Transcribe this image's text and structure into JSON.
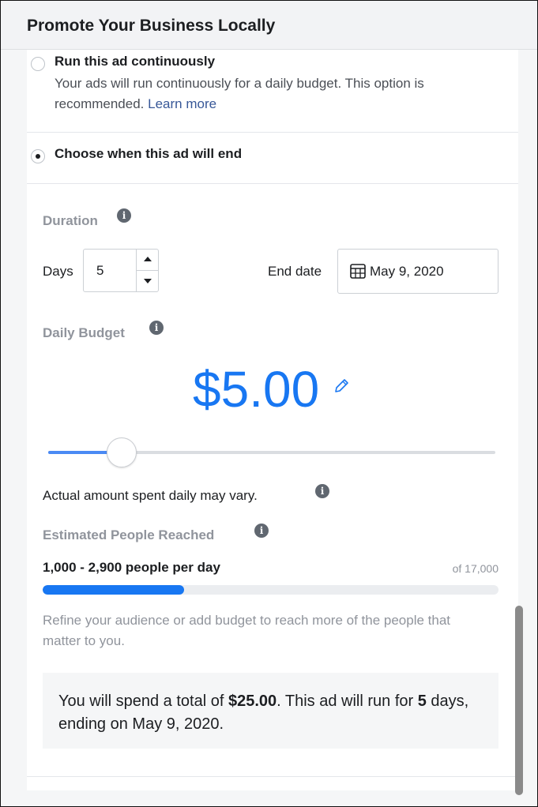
{
  "header": {
    "title": "Promote Your Business Locally"
  },
  "schedule": {
    "continuous": {
      "label": "Run this ad continuously",
      "description": "Your ads will run continuously for a daily budget. This option is recommended.",
      "link": "Learn more",
      "selected": false
    },
    "end_date_option": {
      "label": "Choose when this ad will end",
      "selected": true
    }
  },
  "duration": {
    "section_label": "Duration",
    "days_label": "Days",
    "days_value": "5",
    "end_date_label": "End date",
    "end_date_value": "May 9, 2020"
  },
  "budget": {
    "section_label": "Daily Budget",
    "amount": "$5.00",
    "slider_fraction": 0.17,
    "note": "Actual amount spent daily may vary."
  },
  "reach": {
    "section_label": "Estimated People Reached",
    "range": "1,000 - 2,900 people per day",
    "total": "of 17,000",
    "fraction": 0.31,
    "hint": "Refine your audience or add budget to reach more of the people that matter to you."
  },
  "summary": {
    "prefix": "You will spend a total of ",
    "total": "$25.00",
    "middle": ". This ad will run for ",
    "days": "5",
    "suffix": " days, ending on May 9, 2020."
  },
  "colors": {
    "accent": "#1877f2",
    "slider_fill": "#4a8af4",
    "muted_text": "#90949c",
    "link": "#385898"
  },
  "icons": {
    "info": "info-icon",
    "calendar": "calendar-icon",
    "edit": "pencil-icon"
  }
}
